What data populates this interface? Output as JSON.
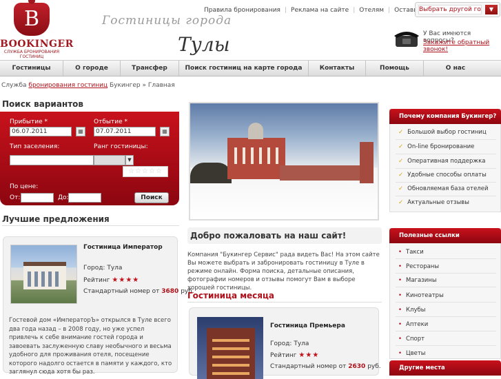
{
  "header": {
    "logo_name": "BOOKINGER",
    "logo_letter": "B",
    "logo_tagline": "СЛУЖБА БРОНИРОВАНИЯ ГОСТИНИЦ",
    "script_line1": "Гостиницы  города",
    "script_line2": "Тулы",
    "top_links": [
      "Правила бронирования",
      "Реклама на сайте",
      "Отелям",
      "Оставить отзыв"
    ],
    "city_select_label": "Выбрать другой город",
    "question": "У Вас имеются вопросы?",
    "callback_link": "Закажите обратный звонок!"
  },
  "nav": {
    "items": [
      "Гостиницы",
      "О городе",
      "Трансфер",
      "Поиск гостиниц на карте города",
      "Контакты",
      "Помощь",
      "О нас"
    ]
  },
  "breadcrumb": {
    "prefix": "Служба",
    "link": "бронирования гостиниц",
    "suffix": "Букингер » Главная"
  },
  "search": {
    "title": "Поиск вариантов",
    "arrival_label": "Прибытие *",
    "arrival_value": "06.07.2011",
    "departure_label": "Отбытие *",
    "departure_value": "07.07.2011",
    "room_type_label": "Тип заселения:",
    "rank_label": "Ранг гостиницы:",
    "rank_stars": "☆☆☆☆☆",
    "price_label": "По цене:",
    "from_label": "От:",
    "to_label": "До:",
    "button": "Поиск",
    "calendar_icon": "▦",
    "select_arrow": "▼"
  },
  "best_offers": {
    "title": "Лучшие предложения",
    "hotel_name": "Гостиница Император",
    "city": "Город: Тула",
    "rating_label": "Рейтинг",
    "stars": "★★★★",
    "price_prefix": "Стандартный номер от",
    "price": "3680",
    "price_suffix": "руб.",
    "description": "Гостевой дом «ИмператорЪ» открылся в Туле всего два года назад – в 2008 году, но уже успел привлечь к себе внимание гостей города и завоевать заслуженную славу необычного и весьма удобного для проживания отеля, посещение которого надолго остается в памяти у каждого, кто заглянул сюда хотя бы раз."
  },
  "welcome": {
    "title": "Добро пожаловать на наш сайт!",
    "text": "Компания \"Букингер Сервис\" рада видеть Вас! На этом сайте Вы можете выбрать и забронировать гостиницу в Туле в режиме онлайн. Форма поиска, детальные описания, фотографии номеров и отзывы помогут Вам в выборе хорошей гостиницы."
  },
  "hotel_of_month": {
    "title": "Гостиница месяца",
    "hotel_name": "Гостиница Премьера",
    "city": "Город: Тула",
    "rating_label": "Рейтинг",
    "stars": "★★★",
    "price_prefix": "Стандартный номер от",
    "price": "2630",
    "price_suffix": "руб."
  },
  "why": {
    "title": "Почему компания Букингер?",
    "check_icon": "✓",
    "items": [
      "Большой выбор гостиниц",
      "On-line бронирование",
      "Оперативная поддержка",
      "Удобные способы оплаты",
      "Обновляемая база отелей",
      "Актуальные отзывы"
    ]
  },
  "useful_links": {
    "title": "Полезные ссылки",
    "bullet": "•",
    "items": [
      "Такси",
      "Рестораны",
      "Магазины",
      "Кинотеатры",
      "Клубы",
      "Аптеки",
      "Спорт",
      "Цветы"
    ]
  },
  "other_places": {
    "title": "Другие места"
  },
  "colors": {
    "brand_red": "#b0101a",
    "star_gold": "#d9a400"
  }
}
